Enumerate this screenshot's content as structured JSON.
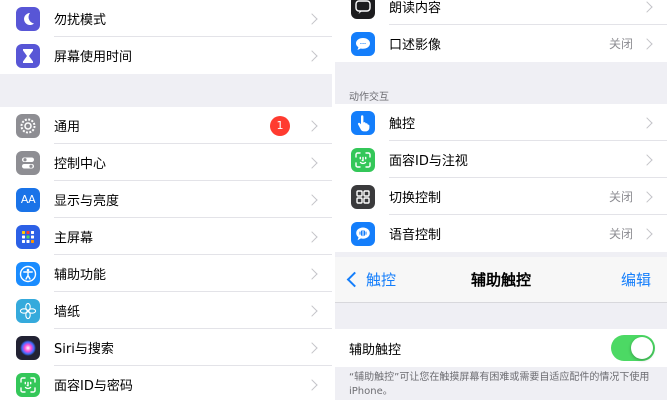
{
  "left": {
    "group1": [
      {
        "label": "勿扰模式",
        "icon": "moon-icon",
        "color": "#5856d6"
      },
      {
        "label": "屏幕使用时间",
        "icon": "hourglass-icon",
        "color": "#5856d6"
      }
    ],
    "group2": [
      {
        "label": "通用",
        "icon": "gear-icon",
        "color": "#8e8e93",
        "badge": "1"
      },
      {
        "label": "控制中心",
        "icon": "toggles-icon",
        "color": "#8e8e93"
      },
      {
        "label": "显示与亮度",
        "icon": "text-size-icon",
        "color": "#1a73e8",
        "glyph": "AA"
      },
      {
        "label": "主屏幕",
        "icon": "home-grid-icon",
        "color": "#2c60e6"
      },
      {
        "label": "辅助功能",
        "icon": "accessibility-icon",
        "color": "#1a8cff"
      },
      {
        "label": "墙纸",
        "icon": "flower-icon",
        "color": "#35aadc"
      },
      {
        "label": "Siri与搜索",
        "icon": "siri-icon",
        "color": "#222233"
      },
      {
        "label": "面容ID与密码",
        "icon": "face-id-icon",
        "color": "#34c759"
      }
    ]
  },
  "right": {
    "top_rows": [
      {
        "label": "朗读内容",
        "icon": "speech-bubble-icon",
        "color": "#1c1c1e",
        "value": ""
      },
      {
        "label": "口述影像",
        "icon": "audio-description-icon",
        "color": "#147efb",
        "value": "关闭"
      }
    ],
    "section_header": "动作交互",
    "interaction_rows": [
      {
        "label": "触控",
        "icon": "hand-pointer-icon",
        "color": "#147efb",
        "value": ""
      },
      {
        "label": "面容ID与注视",
        "icon": "face-id-icon",
        "color": "#34c759",
        "value": ""
      },
      {
        "label": "切换控制",
        "icon": "switch-grid-icon",
        "color": "#3a3a3c",
        "value": "关闭"
      },
      {
        "label": "语音控制",
        "icon": "voice-control-icon",
        "color": "#147efb",
        "value": "关闭"
      }
    ],
    "nav": {
      "back": "触控",
      "title": "辅助触控",
      "edit": "编辑"
    },
    "assistive_row": {
      "label": "辅助触控",
      "on": true
    },
    "footnote": "“辅助触控”可让您在触摸屏幕有困难或需要自适应配件的情况下使用iPhone。"
  }
}
